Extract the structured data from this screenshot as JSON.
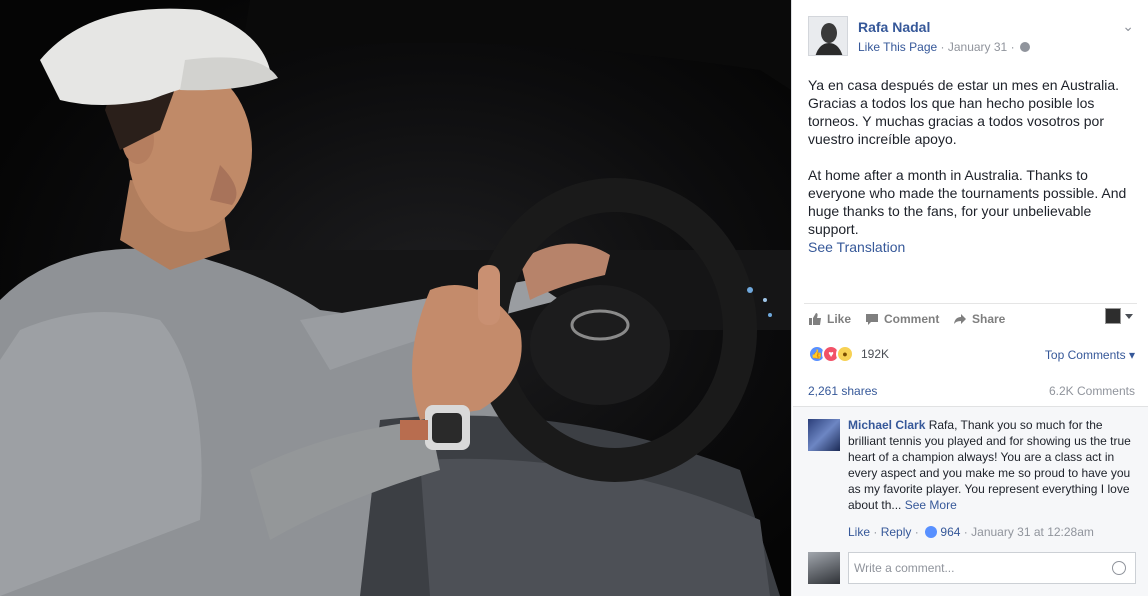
{
  "post": {
    "page_name": "Rafa Nadal",
    "like_page": "Like This Page",
    "date": "January 31",
    "separator": "·",
    "menu_glyph": "⌄",
    "text_spanish": "Ya en casa después de estar un mes en Australia. Gracias a todos los que han hecho posible los torneos. Y muchas gracias a todos vosotros por vuestro increíble apoyo.",
    "text_english": "At home after a month in Australia. Thanks to everyone who made the tournaments possible. And huge thanks to the fans, for your unbelievable support.",
    "see_translation": "See Translation"
  },
  "actions": {
    "like": "Like",
    "comment": "Comment",
    "share": "Share"
  },
  "reactions": {
    "count": "192K",
    "top_comments": "Top Comments",
    "top_comments_caret": "▾",
    "icons": [
      "like-reaction",
      "love-reaction",
      "wow-reaction"
    ],
    "colors": {
      "like": "#5890ff",
      "love": "#f25268",
      "wow": "#f7d154"
    }
  },
  "stats": {
    "shares": "2,261 shares",
    "comments": "6.2K Comments"
  },
  "comment": {
    "author": "Michael Clark",
    "text": "Rafa, Thank you so much for the brilliant tennis you played and for showing us the true heart of a champion always! You are a class act in every aspect and you make me so proud to have you as my favorite player. You represent everything I love about th...",
    "see_more": "See More",
    "like": "Like",
    "reply": "Reply",
    "likes": "964",
    "time": "January 31 at 12:28am"
  },
  "composer": {
    "placeholder": "Write a comment..."
  },
  "theme": {
    "link_color": "#365899",
    "meta_color": "#90949c",
    "text_color": "#1d2129"
  }
}
